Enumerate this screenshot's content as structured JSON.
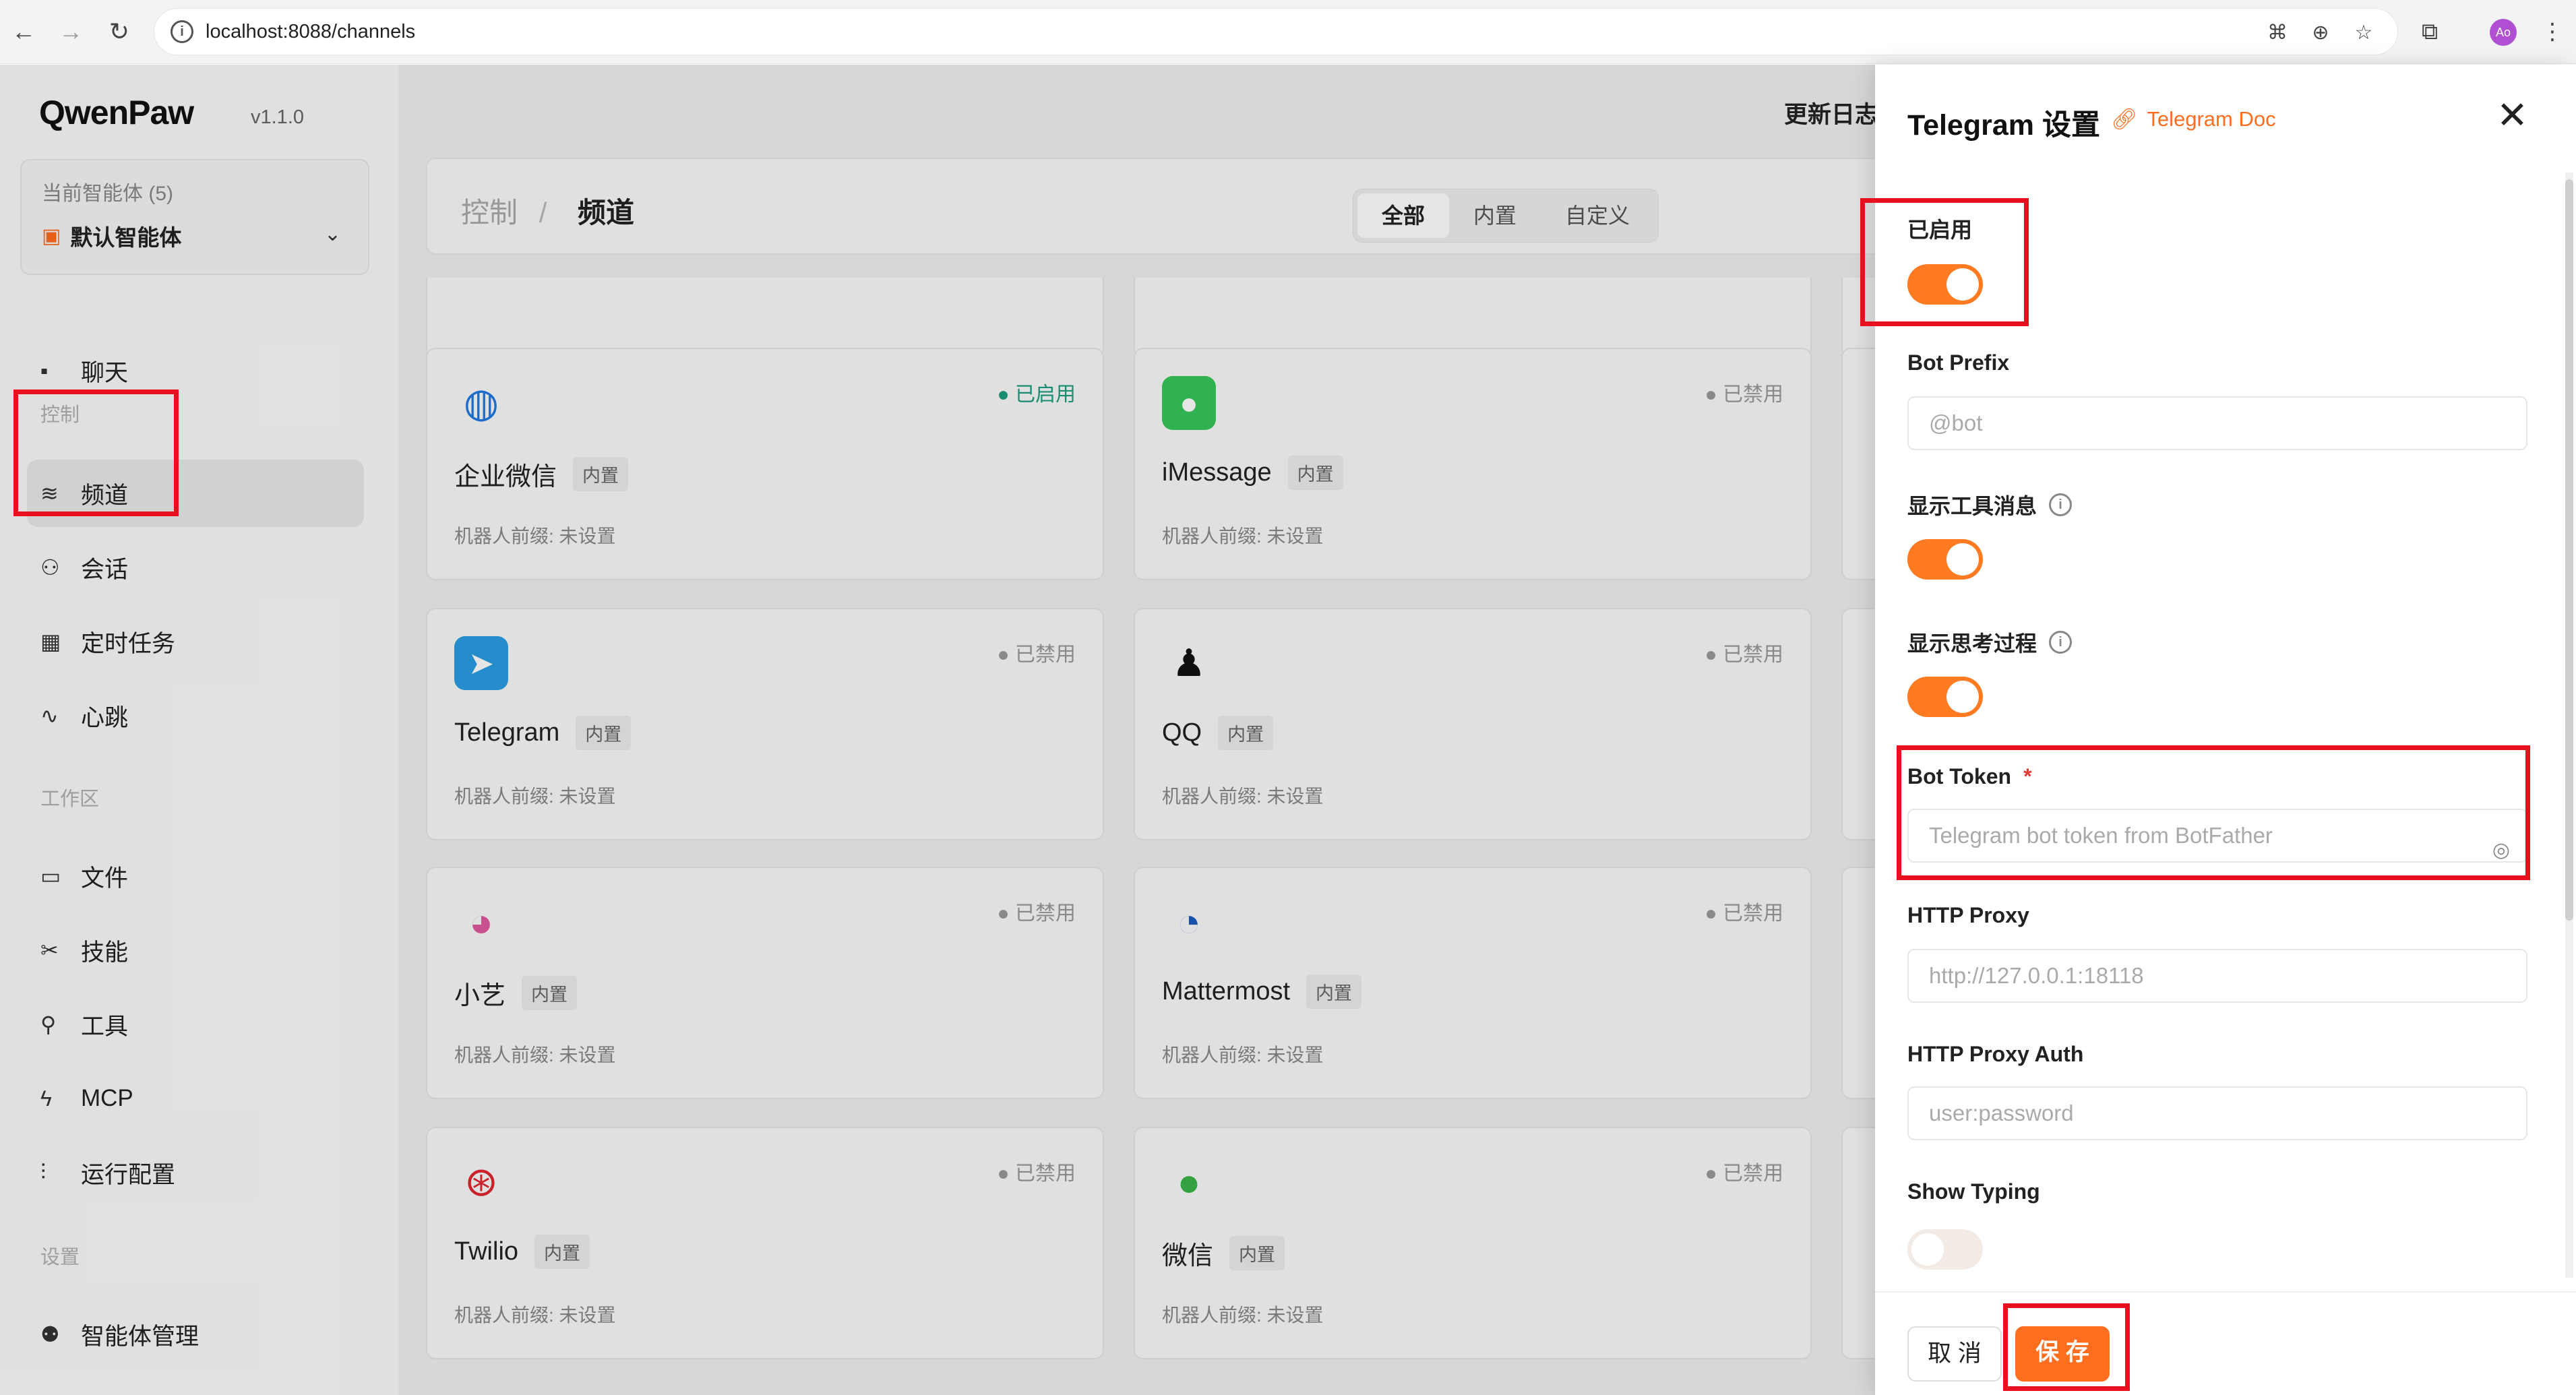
{
  "browser": {
    "url": "localhost:8088/channels",
    "avatar_initials": "Ao"
  },
  "sidebar": {
    "logo": "QwenPaw",
    "version": "v1.1.0",
    "agent_label": "当前智能体 (5)",
    "agent_name": "默认智能体",
    "items": [
      {
        "label": "聊天",
        "icon": "chat-icon"
      },
      {
        "label": "频道",
        "icon": "wifi-icon"
      },
      {
        "label": "会话",
        "icon": "users-icon"
      },
      {
        "label": "定时任务",
        "icon": "calendar-icon"
      },
      {
        "label": "心跳",
        "icon": "pulse-icon"
      },
      {
        "label": "文件",
        "icon": "folder-icon"
      },
      {
        "label": "技能",
        "icon": "skill-icon"
      },
      {
        "label": "工具",
        "icon": "tool-icon"
      },
      {
        "label": "MCP",
        "icon": "bolt-icon"
      },
      {
        "label": "运行配置",
        "icon": "sliders-icon"
      },
      {
        "label": "智能体管理",
        "icon": "agent-icon"
      }
    ],
    "sections": {
      "control": "控制",
      "workspace": "工作区",
      "settings": "设置"
    }
  },
  "header": {
    "crumb_parent": "控制",
    "crumb_sep": "/",
    "crumb_current": "频道",
    "tabs": [
      "全部",
      "内置",
      "自定义"
    ],
    "changelog": "更新日志"
  },
  "cards": [
    {
      "name": "企业微信",
      "tag": "内置",
      "status": "● 已启用",
      "prefix": "机器人前缀: 未设置"
    },
    {
      "name": "iMessage",
      "tag": "内置",
      "status": "● 已禁用",
      "prefix": "机器人前缀: 未设置"
    },
    {
      "name": "Telegram",
      "tag": "内置",
      "status": "● 已禁用",
      "prefix": "机器人前缀: 未设置"
    },
    {
      "name": "QQ",
      "tag": "内置",
      "status": "● 已禁用",
      "prefix": "机器人前缀: 未设置"
    },
    {
      "name": "小艺",
      "tag": "内置",
      "status": "● 已禁用",
      "prefix": "机器人前缀: 未设置"
    },
    {
      "name": "Mattermost",
      "tag": "内置",
      "status": "● 已禁用",
      "prefix": "机器人前缀: 未设置"
    },
    {
      "name": "Twilio",
      "tag": "内置",
      "status": "● 已禁用",
      "prefix": "机器人前缀: 未设置"
    },
    {
      "name": "微信",
      "tag": "内置",
      "status": "● 已禁用",
      "prefix": "机器人前缀: 未设置"
    }
  ],
  "drawer": {
    "title": "Telegram 设置",
    "doc_link": "Telegram Doc",
    "enabled_label": "已启用",
    "bot_prefix_label": "Bot Prefix",
    "bot_prefix_placeholder": "@bot",
    "show_tool_label": "显示工具消息",
    "show_thinking_label": "显示思考过程",
    "bot_token_label": "Bot Token",
    "bot_token_required": "*",
    "bot_token_placeholder": "Telegram bot token from BotFather",
    "http_proxy_label": "HTTP Proxy",
    "http_proxy_placeholder": "http://127.0.0.1:18118",
    "http_proxy_auth_label": "HTTP Proxy Auth",
    "http_proxy_auth_placeholder": "user:password",
    "show_typing_label": "Show Typing",
    "cancel_label": "取 消",
    "save_label": "保 存"
  },
  "colors": {
    "accent": "#ff6d1f",
    "enabled_status": "#1e9e7d",
    "highlight": "#e8101e"
  }
}
